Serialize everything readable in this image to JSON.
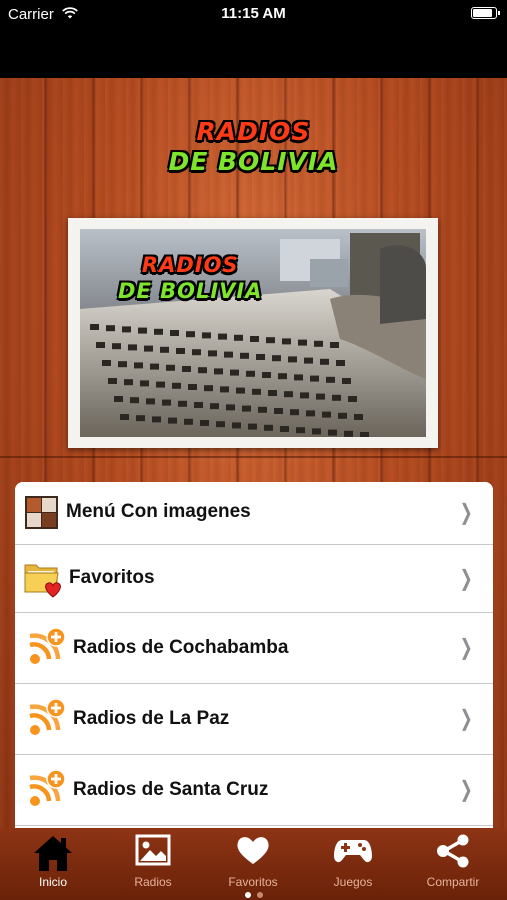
{
  "status_bar": {
    "carrier": "Carrier",
    "time": "11:15 AM",
    "battery_level": 0.95
  },
  "logo": {
    "line1": "RADIOS",
    "line2": "DE BOLIVIA"
  },
  "banner": {
    "logo_line1": "RADIOS",
    "logo_line2": "DE BOLIVIA"
  },
  "menu": [
    {
      "label": "Menú Con imagenes",
      "icon": "grid-icon"
    },
    {
      "label": "Favoritos",
      "icon": "heart-folder-icon"
    },
    {
      "label": "Radios de Cochabamba",
      "icon": "rss-add-icon"
    },
    {
      "label": "Radios de La Paz",
      "icon": "rss-add-icon"
    },
    {
      "label": "Radios de Santa Cruz",
      "icon": "rss-add-icon"
    }
  ],
  "tabs": [
    {
      "label": "Inicio",
      "icon": "home-icon",
      "active": true
    },
    {
      "label": "Radios",
      "icon": "image-icon",
      "active": false
    },
    {
      "label": "Favoritos",
      "icon": "heart-icon",
      "active": false
    },
    {
      "label": "Juegos",
      "icon": "gamepad-icon",
      "active": false
    },
    {
      "label": "Compartir",
      "icon": "share-icon",
      "active": false
    }
  ],
  "page_indicator": {
    "pages": 2,
    "current": 1
  },
  "colors": {
    "accent_red": "#ff3a17",
    "accent_green": "#7fe52c",
    "tabbar": "#7a2a0e",
    "rss_orange": "#f7941d"
  }
}
